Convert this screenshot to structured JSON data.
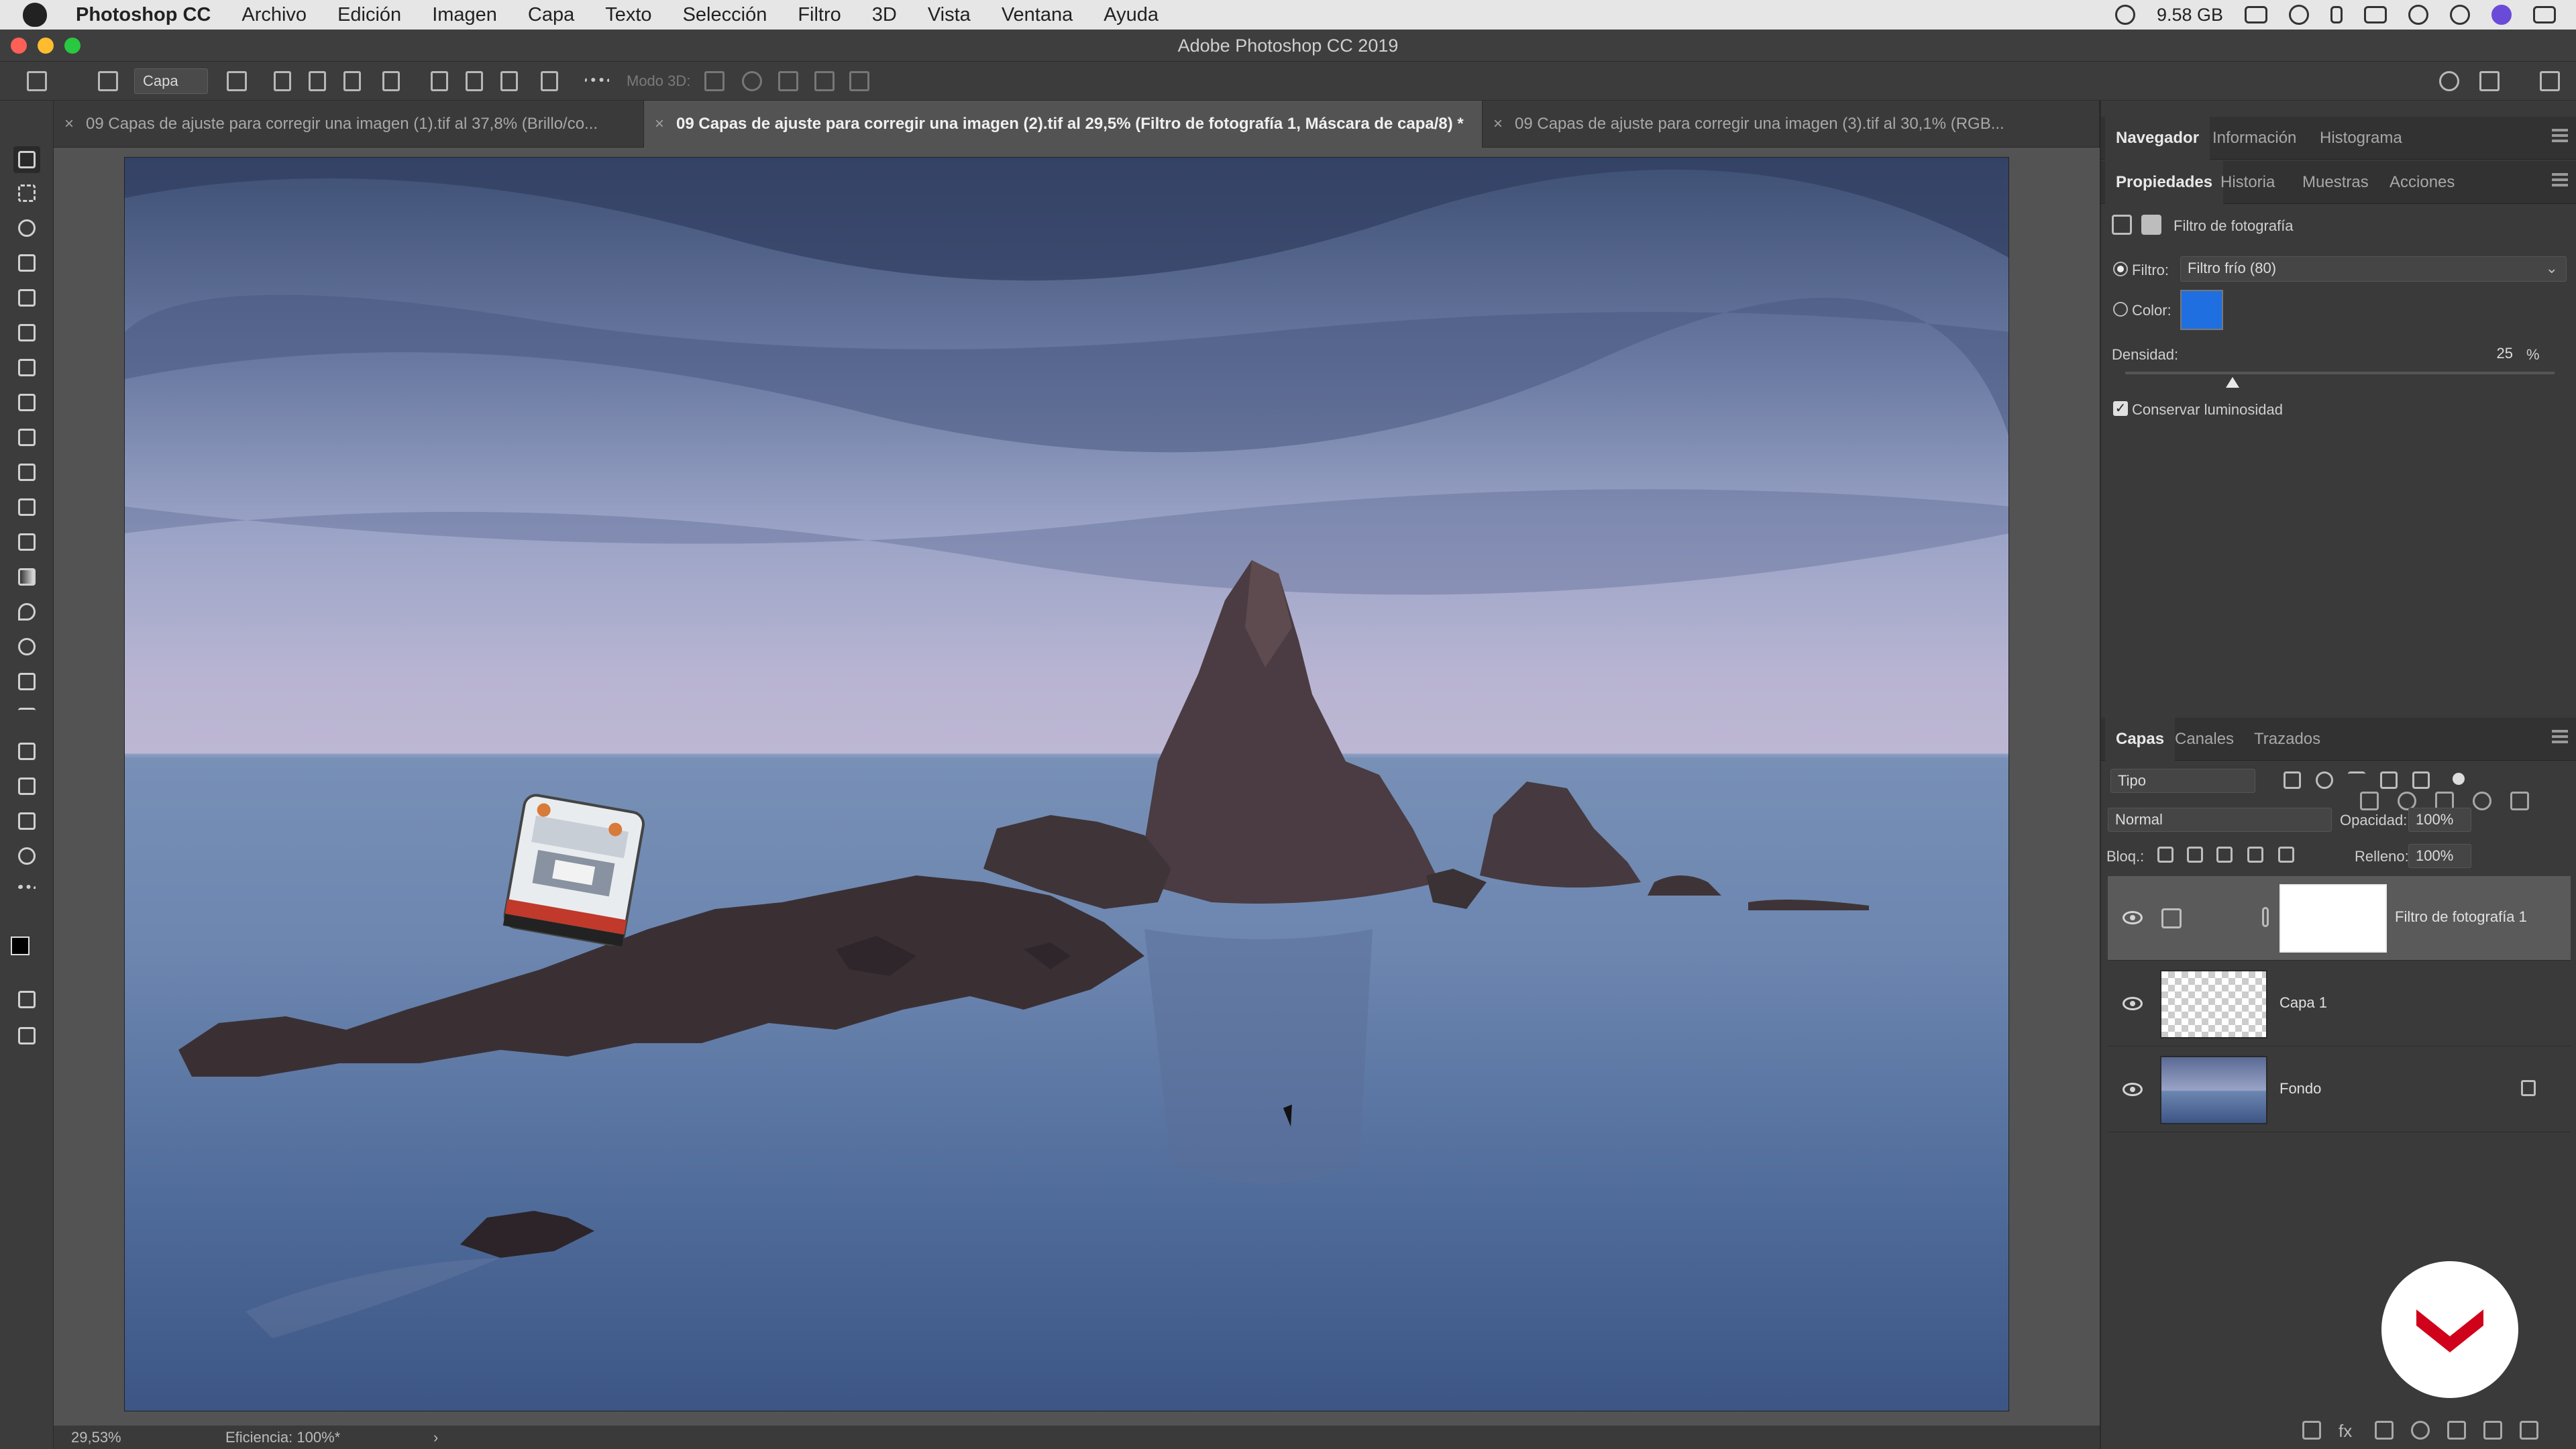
{
  "menubar": {
    "app_name": "Photoshop CC",
    "items": [
      "Archivo",
      "Edición",
      "Imagen",
      "Capa",
      "Texto",
      "Selección",
      "Filtro",
      "3D",
      "Vista",
      "Ventana",
      "Ayuda"
    ],
    "memory": "9.58 GB"
  },
  "window": {
    "title": "Adobe Photoshop CC 2019"
  },
  "options_bar": {
    "auto_select": "Capa",
    "mode_3d_label": "Modo 3D:"
  },
  "doc_tabs": [
    {
      "label": "09 Capas de ajuste para corregir una imagen (1).tif al 37,8% (Brillo/co..."
    },
    {
      "label": "09 Capas de ajuste para corregir una imagen (2).tif al 29,5% (Filtro de fotografía 1, Máscara de capa/8) *"
    },
    {
      "label": "09 Capas de ajuste para corregir una imagen (3).tif al 30,1% (RGB..."
    }
  ],
  "tab_close_glyph": "×",
  "status_bar": {
    "zoom": "29,53%",
    "efficiency": "Eficiencia: 100%*",
    "arrow": "›"
  },
  "top_panel": {
    "tabs": [
      "Navegador",
      "Información",
      "Histograma"
    ],
    "active": "Navegador"
  },
  "properties_panel": {
    "tabs": [
      "Propiedades",
      "Historia",
      "Muestras",
      "Acciones"
    ],
    "active": "Propiedades",
    "header": "Filtro de fotografía",
    "filter_label": "Filtro:",
    "filter_value": "Filtro frío (80)",
    "color_label": "Color:",
    "color_swatch": "#1f6fe0",
    "density_label": "Densidad:",
    "density_value": "25",
    "density_unit": "%",
    "density_level": 0.25,
    "preserve_label": "Conservar luminosidad",
    "preserve_checked": true
  },
  "layers_panel": {
    "tabs": [
      "Capas",
      "Canales",
      "Trazados"
    ],
    "active": "Capas",
    "filter_kind": "Tipo",
    "blend_mode": "Normal",
    "opacity_label": "Opacidad:",
    "opacity_value": "100%",
    "lock_label": "Bloq.:",
    "fill_label": "Relleno:",
    "fill_value": "100%",
    "layers": [
      {
        "name": "Filtro de fotografía 1",
        "type": "adjustment",
        "selected": true
      },
      {
        "name": "Capa 1",
        "type": "pixel",
        "selected": false
      },
      {
        "name": "Fondo",
        "type": "background",
        "locked": true,
        "selected": false
      }
    ]
  },
  "colors": {
    "accent_blue": "#1f6fe0",
    "panel_bg": "#3a3a3a",
    "canvas_bg": "#535353",
    "logo_red": "#d0021b"
  }
}
